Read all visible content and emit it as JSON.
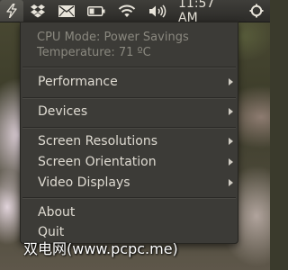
{
  "panel": {
    "clock": "11:57 AM",
    "indicators": [
      {
        "name": "jupiter-power-icon"
      },
      {
        "name": "dropbox-icon"
      },
      {
        "name": "mail-icon"
      },
      {
        "name": "battery-icon"
      },
      {
        "name": "wifi-icon"
      },
      {
        "name": "volume-icon"
      }
    ]
  },
  "menu": {
    "cpu_mode": "CPU Mode: Power Savings",
    "temperature": "Temperature: 71 ºC",
    "items": {
      "performance": "Performance",
      "devices": "Devices",
      "screen_resolutions": "Screen Resolutions",
      "screen_orientation": "Screen Orientation",
      "video_displays": "Video Displays",
      "about": "About",
      "quit": "Quit"
    }
  },
  "watermark": "双电网(www.pcpc.me)",
  "colors": {
    "panel_bg": "#2c2b28",
    "menu_bg": "#3c3b37",
    "menu_text": "#dfdbd2",
    "disabled_text": "#8a887f"
  }
}
